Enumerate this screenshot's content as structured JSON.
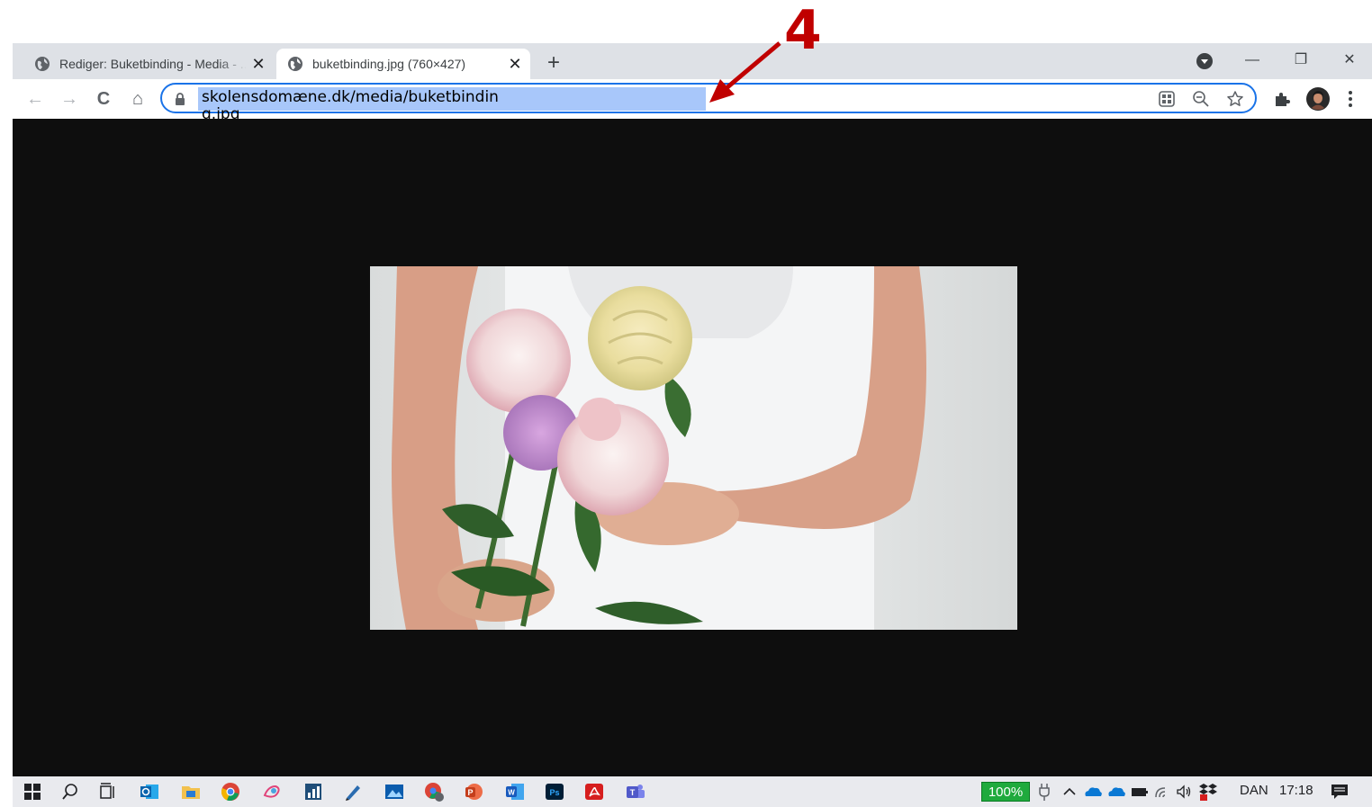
{
  "annotation": {
    "label": "4",
    "color": "#c00000"
  },
  "browser": {
    "tabs": [
      {
        "title": "Rediger: Buketbinding - Media - ...",
        "close_glyph": "✕",
        "active": false
      },
      {
        "title": "buketbinding.jpg (760×427)",
        "close_glyph": "✕",
        "active": true
      }
    ],
    "new_tab_glyph": "+",
    "window_controls": {
      "minimize": "—",
      "restore": "❐",
      "close": "✕"
    },
    "nav": {
      "back": "←",
      "forward": "→",
      "reload": "C",
      "home": "⌂"
    },
    "address": {
      "url": "skolensdomæne.dk/media/buketbinding.jpg",
      "selected": true
    },
    "icons": [
      "lock-icon",
      "qr-code-icon",
      "zoom-out-icon",
      "bookmark-star-icon",
      "extensions-puzzle-icon",
      "profile-avatar-icon",
      "kebab-menu-icon"
    ],
    "accent_color": "#1a73e8"
  },
  "viewer": {
    "background_color": "#0e0e0e",
    "image": "photo of a person in a white top holding a bouquet of pink peonies, a cream rose and a purple allium"
  },
  "taskbar": {
    "battery": "100%",
    "language": "DAN",
    "time": "17:18",
    "pinned_apps": [
      "start-windows-icon",
      "search-icon",
      "task-view-icon",
      "outlook-icon",
      "file-explorer-icon",
      "chrome-icon",
      "paint-3d-icon",
      "chart-app-icon",
      "pen-app-icon",
      "photos-icon",
      "chrome-alt-icon",
      "powerpoint-icon",
      "word-icon",
      "photoshop-icon",
      "acrobat-icon",
      "teams-icon"
    ]
  }
}
